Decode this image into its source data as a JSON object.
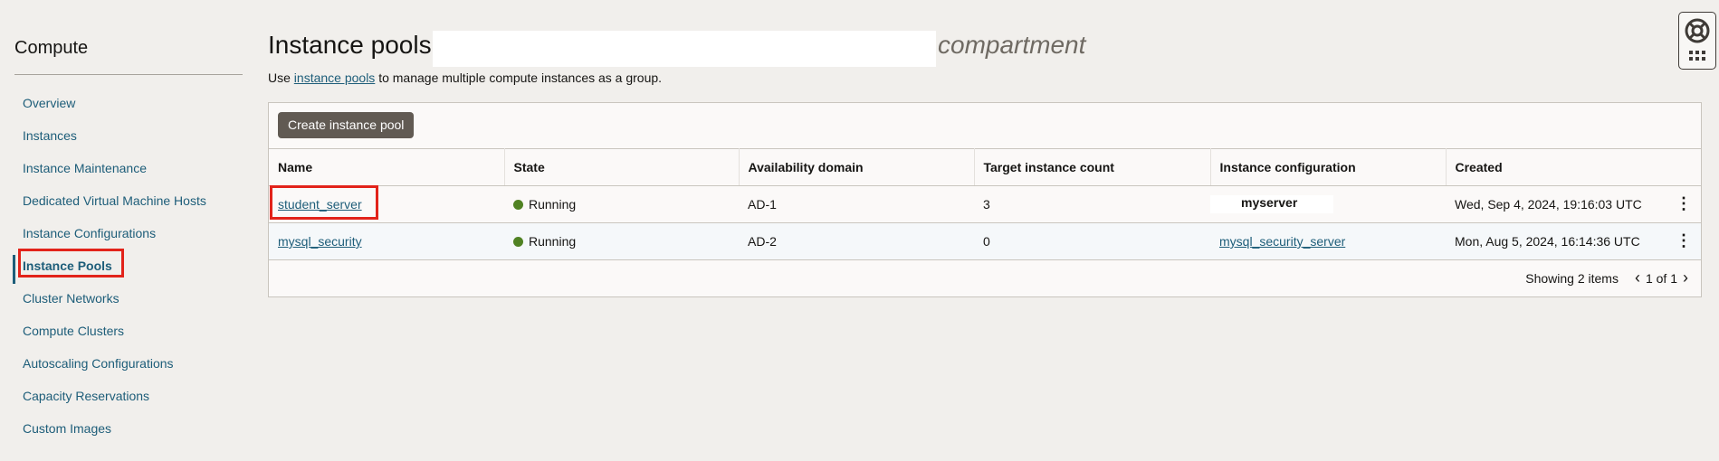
{
  "sidebar": {
    "title": "Compute",
    "items": [
      {
        "label": "Overview",
        "active": false
      },
      {
        "label": "Instances",
        "active": false
      },
      {
        "label": "Instance Maintenance",
        "active": false
      },
      {
        "label": "Dedicated Virtual Machine Hosts",
        "active": false
      },
      {
        "label": "Instance Configurations",
        "active": false
      },
      {
        "label": "Instance Pools",
        "active": true
      },
      {
        "label": "Cluster Networks",
        "active": false
      },
      {
        "label": "Compute Clusters",
        "active": false
      },
      {
        "label": "Autoscaling Configurations",
        "active": false
      },
      {
        "label": "Capacity Reservations",
        "active": false
      },
      {
        "label": "Custom Images",
        "active": false
      }
    ]
  },
  "header": {
    "title": "Instance pools",
    "compartment_suffix": "compartment",
    "subtitle_prefix": "Use ",
    "subtitle_link": "instance pools",
    "subtitle_suffix": " to manage multiple compute instances as a group."
  },
  "toolbar": {
    "create_label": "Create instance pool"
  },
  "table": {
    "columns": [
      "Name",
      "State",
      "Availability domain",
      "Target instance count",
      "Instance configuration",
      "Created"
    ],
    "rows": [
      {
        "name": "student_server",
        "state": "Running",
        "ad": "AD-1",
        "count": "3",
        "config": "myserver",
        "created": "Wed, Sep 4, 2024, 19:16:03 UTC"
      },
      {
        "name": "mysql_security",
        "state": "Running",
        "ad": "AD-2",
        "count": "0",
        "config": "mysql_security_server",
        "created": "Mon, Aug 5, 2024, 16:14:36 UTC"
      }
    ]
  },
  "pager": {
    "showing": "Showing 2 items",
    "page": "1 of 1"
  },
  "colors": {
    "accent": "#1d5d79",
    "running": "#508223",
    "highlight": "#e2231a",
    "button": "#615a53"
  },
  "icons": {
    "help": "lifebuoy-icon",
    "apps": "grid-icon",
    "row_menu": "kebab-icon",
    "prev": "chevron-left-icon",
    "next": "chevron-right-icon"
  }
}
